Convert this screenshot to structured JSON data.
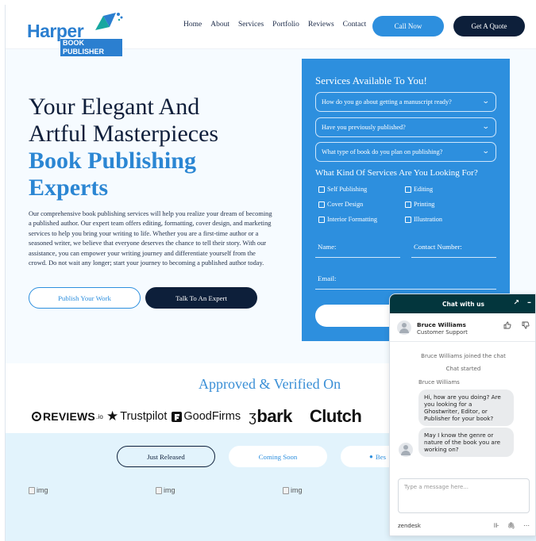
{
  "header": {
    "logo_top": "Harper",
    "logo_bottom": "BOOK PUBLISHER",
    "nav": [
      "Home",
      "About",
      "Services",
      "Portfolio",
      "Reviews",
      "Contact"
    ],
    "call_label": "Call Now",
    "quote_label": "Get A Quote"
  },
  "hero": {
    "title_line1": "Your Elegant And",
    "title_line2": "Artful Masterpieces",
    "title_line3": "Book Publishing",
    "title_line4": "Experts",
    "description": "Our comprehensive book publishing services will help you realize your dream of becoming a published author. Our expert team offers editing, formatting, cover design, and marketing services to help you bring your writing to life. Whether you are a first-time author or a seasoned writer, we believe that everyone deserves the chance to tell their story. With our assistance, you can empower your writing journey and differentiate yourself from the crowd. Do not wait any longer; start your journey to becoming a published author today.",
    "publish_label": "Publish Your Work",
    "talk_label": "Talk To An Expert"
  },
  "form": {
    "title": "Services Available To You!",
    "selects": [
      "How do you go about getting a manuscript ready?",
      "Have you previously published?",
      "What type of book do you plan on publishing?"
    ],
    "services_heading": "What Kind Of Services Are You Looking For?",
    "checkboxes": [
      "Self Publishing",
      "Editing",
      "Cover Design",
      "Printing",
      "Interior Formatting",
      "Illustration"
    ],
    "name_label": "Name:",
    "contact_label": "Contact Number:",
    "email_label": "Email:"
  },
  "approved": {
    "title": "Approved & Verified On",
    "brands": {
      "reviews": "REVIEWS",
      "reviews_suffix": ".io",
      "trustpilot": "Trustpilot",
      "goodfirms": "GoodFirms",
      "bark": "bark",
      "clutch": "Clutch"
    }
  },
  "tabs": {
    "items": [
      "Just Released",
      "Coming Soon",
      "Bes"
    ],
    "img_alt": "img"
  },
  "chat": {
    "header": "Chat with us",
    "agent_name": "Bruce Williams",
    "agent_role": "Customer Support",
    "joined": "Bruce Williams joined the chat",
    "started": "Chat started",
    "sender": "Bruce Williams",
    "msg1": "Hi, how are you doing? Are you looking for a Ghostwriter, Editor, or Publisher for your book?",
    "msg2": "May I know the genre or nature of the book you are working on?",
    "placeholder": "Type a message here...",
    "brand": "zendesk"
  },
  "colors": {
    "accent": "#2d8fde",
    "navy": "#0d1f3a",
    "zendesk": "#03363d"
  }
}
